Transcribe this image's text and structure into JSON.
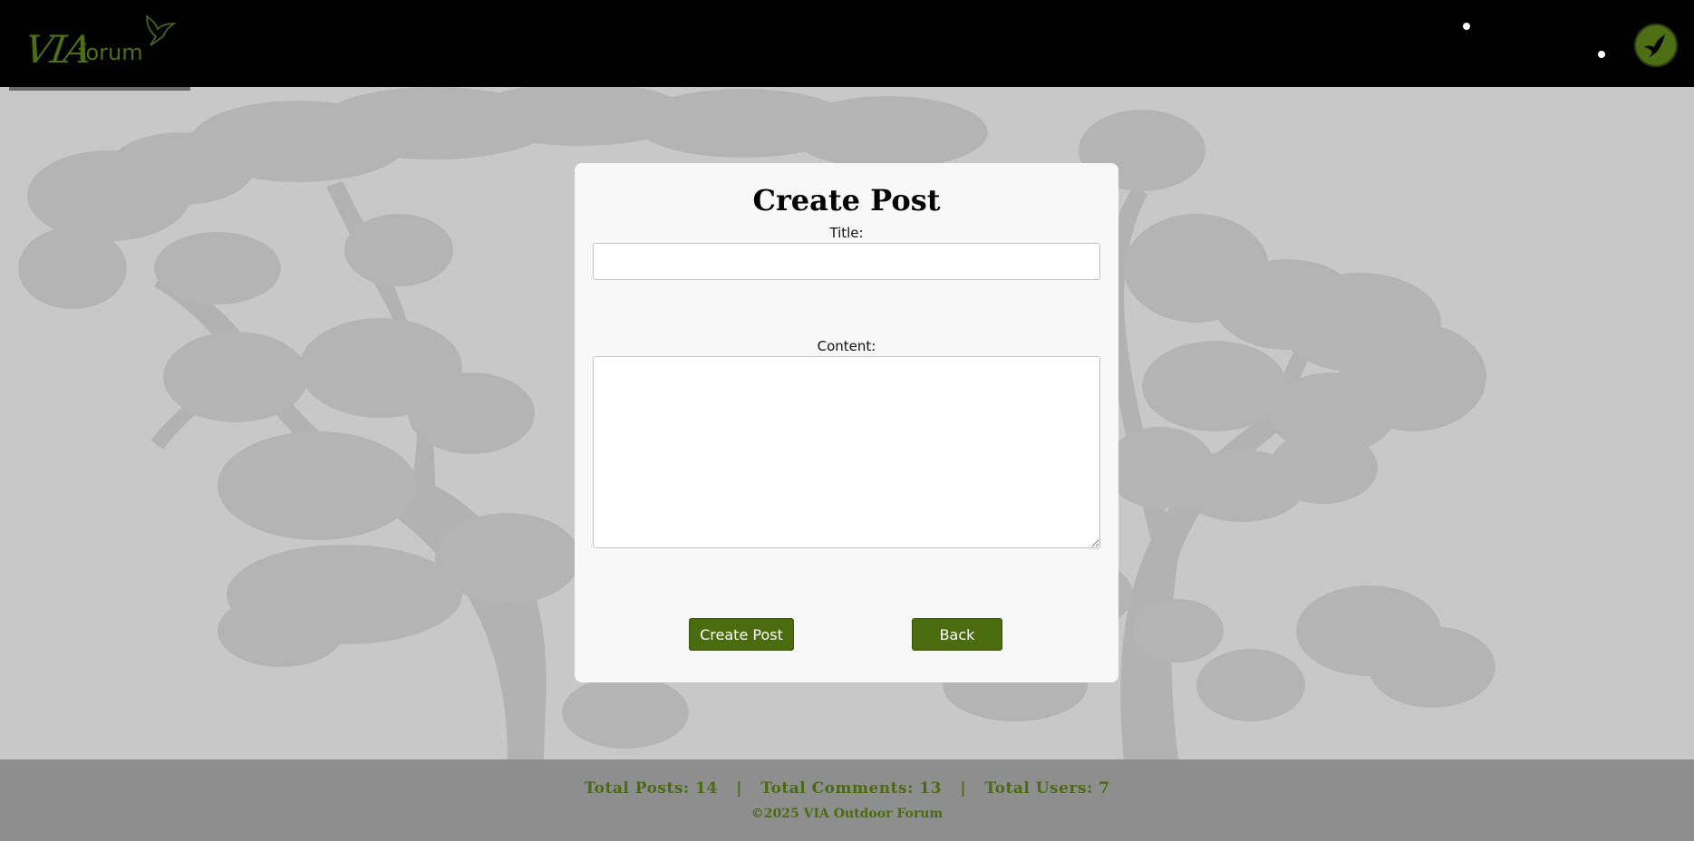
{
  "header": {
    "logo_main": "VIA",
    "logo_sub": "forum"
  },
  "form": {
    "heading": "Create Post",
    "title_label": "Title:",
    "title_value": "",
    "content_label": "Content:",
    "content_value": "",
    "submit_label": "Create Post",
    "back_label": "Back"
  },
  "footer": {
    "posts_label": "Total Posts:",
    "posts_count": "14",
    "comments_label": "Total Comments:",
    "comments_count": "13",
    "users_label": "Total Users:",
    "users_count": "7",
    "separator": "|",
    "copyright": "©2025 VIA Outdoor Forum"
  },
  "colors": {
    "header_bg": "#000000",
    "accent_green": "#4a6b0e",
    "page_bg": "#c8c8c8",
    "tree_silhouette": "#b0b0b0",
    "footer_bg": "#8e8e8e",
    "card_bg": "#f8f8f8"
  },
  "icons": {
    "logo_bird": "bird-icon",
    "avatar": "bird-avatar-icon"
  }
}
